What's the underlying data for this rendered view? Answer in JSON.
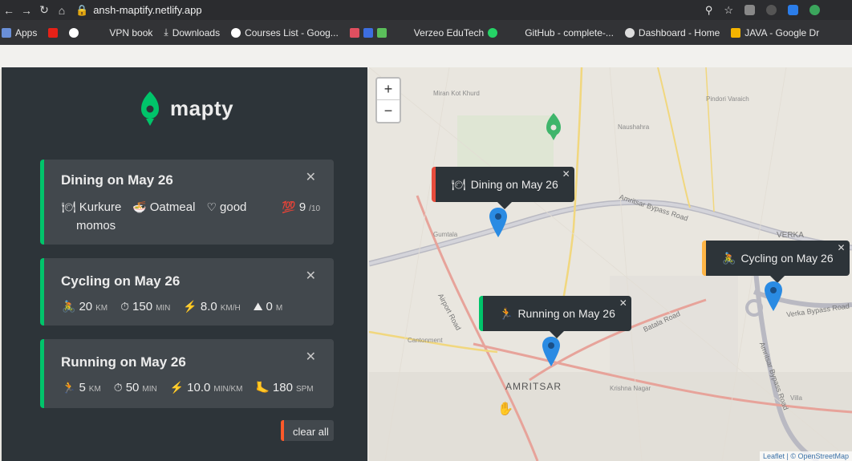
{
  "browser": {
    "url": "ansh-maptify.netlify.app",
    "bookmarks": [
      "Apps",
      "VPN book",
      "Downloads",
      "Courses List - Goog...",
      "Verzeo EduTech",
      "GitHub - complete-...",
      "Dashboard - Home",
      "JAVA - Google Dr"
    ]
  },
  "app": {
    "name": "mapty",
    "clear_all_label": "clear all"
  },
  "workouts": [
    {
      "title": "Dining on May 26",
      "type_color": "#00c46a",
      "details": [
        {
          "icon": "🍽",
          "value": "Kurkure",
          "unit": ""
        },
        {
          "icon": "🍜",
          "value": "Oatmeal",
          "unit": ""
        },
        {
          "icon": "♡",
          "value": "good",
          "unit": ""
        },
        {
          "icon": "💯",
          "value": "9",
          "unit": "/10"
        }
      ],
      "extra": "momos"
    },
    {
      "title": "Cycling on May 26",
      "type_color": "#00c46a",
      "details": [
        {
          "icon": "🚴",
          "value": "20",
          "unit": "KM"
        },
        {
          "icon": "⏱",
          "value": "150",
          "unit": "MIN"
        },
        {
          "icon": "⚡",
          "value": "8.0",
          "unit": "KM/H"
        },
        {
          "icon": "⛰",
          "value": "0",
          "unit": "M"
        }
      ]
    },
    {
      "title": "Running on May 26",
      "type_color": "#00c46a",
      "details": [
        {
          "icon": "🏃",
          "value": "5",
          "unit": "KM"
        },
        {
          "icon": "⏱",
          "value": "50",
          "unit": "MIN"
        },
        {
          "icon": "⚡",
          "value": "10.0",
          "unit": "MIN/KM"
        },
        {
          "icon": "🦶",
          "value": "180",
          "unit": "SPM"
        }
      ]
    }
  ],
  "map": {
    "zoom_in": "+",
    "zoom_out": "−",
    "popups": [
      {
        "icon": "🍽",
        "label": "Dining on May 26",
        "accent": "#e74c3c"
      },
      {
        "icon": "🚴",
        "label": "Cycling on May 26",
        "accent": "#ffb545"
      },
      {
        "icon": "🏃",
        "label": "Running on May 26",
        "accent": "#00c46a"
      }
    ],
    "place_labels": [
      "AMRITSAR",
      "VERKA",
      "Amritsar Bypass Road",
      "Verka Bypass Road",
      "Batala Road",
      "Airport Road",
      "Cantonment",
      "Gumtala",
      "Naushahra",
      "Miran Kot Khurd",
      "Pindori Varaich",
      "Krishna Nagar",
      "Amritsar Bypass Road",
      "Villa"
    ],
    "attribution": "Leaflet | © OpenStreetMap"
  }
}
